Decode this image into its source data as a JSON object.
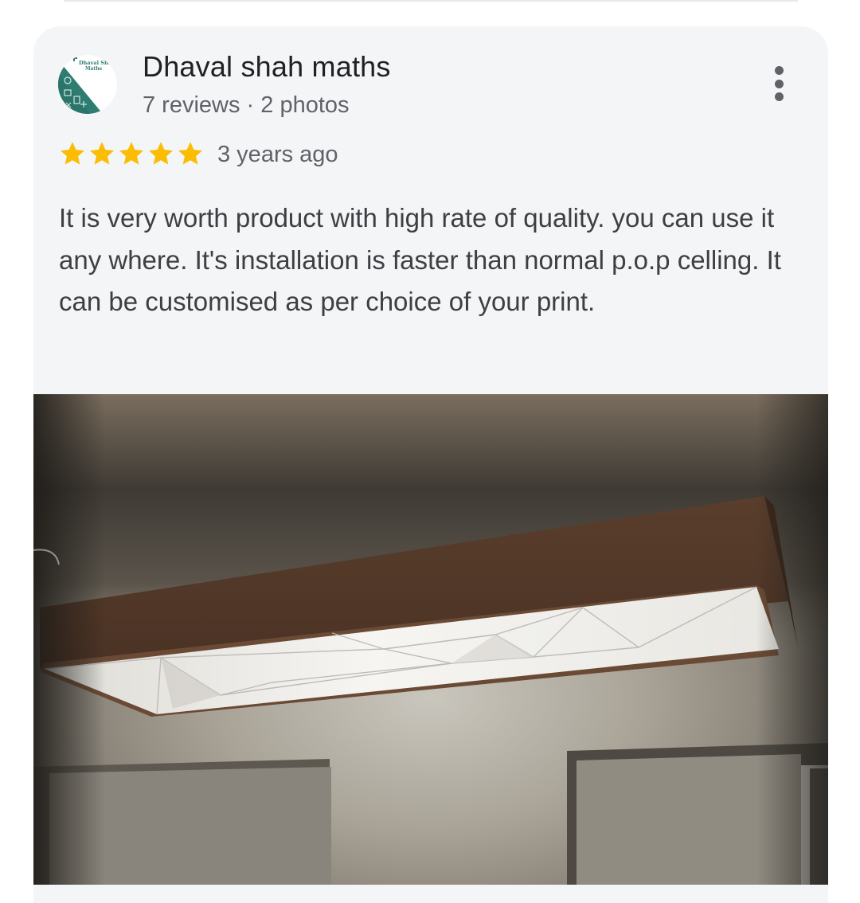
{
  "review": {
    "reviewer_name": "Dhaval shah maths",
    "avatar_text_line1": "Dhaval Sha",
    "avatar_text_line2": "Maths",
    "reviewer_meta": "7 reviews · 2 photos",
    "rating": 5,
    "rating_max": 5,
    "age": "3 years ago",
    "text": "It is very worth product with high rate of quality. you can use it any where. It's installation is faster than normal p.o.p celling. It can be customised as per choice of your print.",
    "photo_count_shown": 1
  },
  "colors": {
    "card_background": "#f4f5f7",
    "star": "#fbbc04",
    "name_text": "#202124",
    "secondary_text": "#5f6368",
    "body_text": "#3c4043",
    "avatar_accent": "#2f7d72"
  },
  "icons": {
    "more": "more-vert-icon",
    "star": "star-icon"
  }
}
